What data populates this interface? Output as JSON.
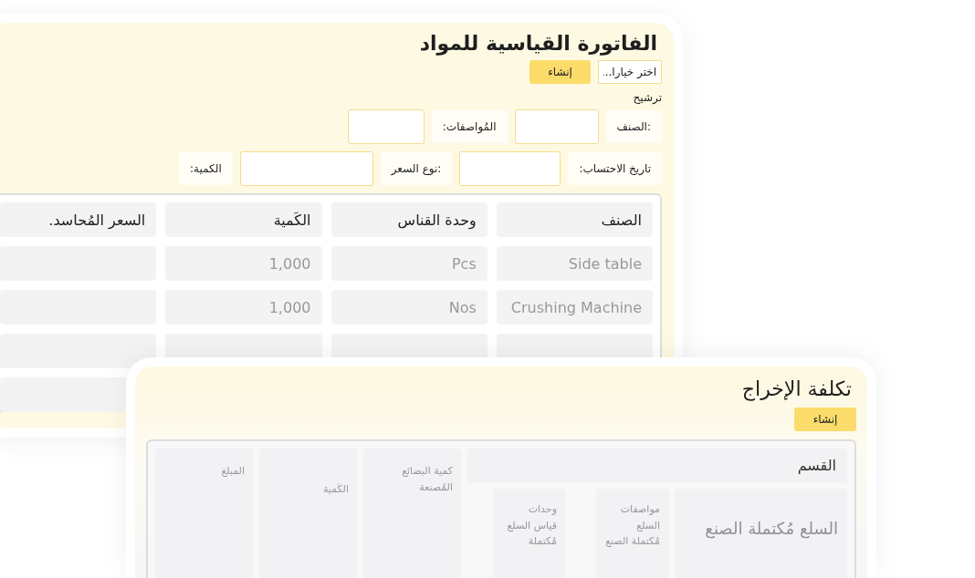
{
  "invoice": {
    "title": "الفاتورة القياسية للمواد",
    "select": {
      "placeholder": "اختر خيارا..."
    },
    "create_button": "إنشاء",
    "filter_label": "ترشيح",
    "filter_rows": [
      [
        {
          "kind": "label",
          "text": ":الصنف"
        },
        {
          "kind": "field"
        },
        {
          "kind": "label",
          "text": "المُواصفات:"
        },
        {
          "kind": "field"
        }
      ],
      [
        {
          "kind": "label",
          "text": "تاريخ الاحتساب:"
        },
        {
          "kind": "field"
        },
        {
          "kind": "label",
          "text": ":نوع السعر"
        },
        {
          "kind": "field"
        },
        {
          "kind": "label",
          "text": "الكمية:"
        }
      ]
    ],
    "table": {
      "columns": [
        "الصنف",
        "وحدة القناس",
        "الكَمية",
        "السعر المُحاسد."
      ],
      "rows": [
        [
          "Side table",
          "Pcs",
          "1,000",
          null
        ],
        [
          "Crushing Machine",
          "Nos",
          "1,000",
          null
        ],
        [
          null,
          null,
          null,
          null
        ],
        [
          null,
          null,
          null,
          null
        ]
      ]
    }
  },
  "output_cost": {
    "title": "تكلفة الإخراج",
    "create_button": "إنشاء",
    "table": {
      "group_header": "القسم",
      "group_columns": [
        "السلع مُكتملة الصنع",
        "مواصفات السلع مُكتملة الصنع",
        "وحدات قياس السلع مُكتملة"
      ],
      "columns": [
        "كمية البضائع المُصنعة",
        "الكَمية",
        "المبلغ"
      ]
    }
  }
}
